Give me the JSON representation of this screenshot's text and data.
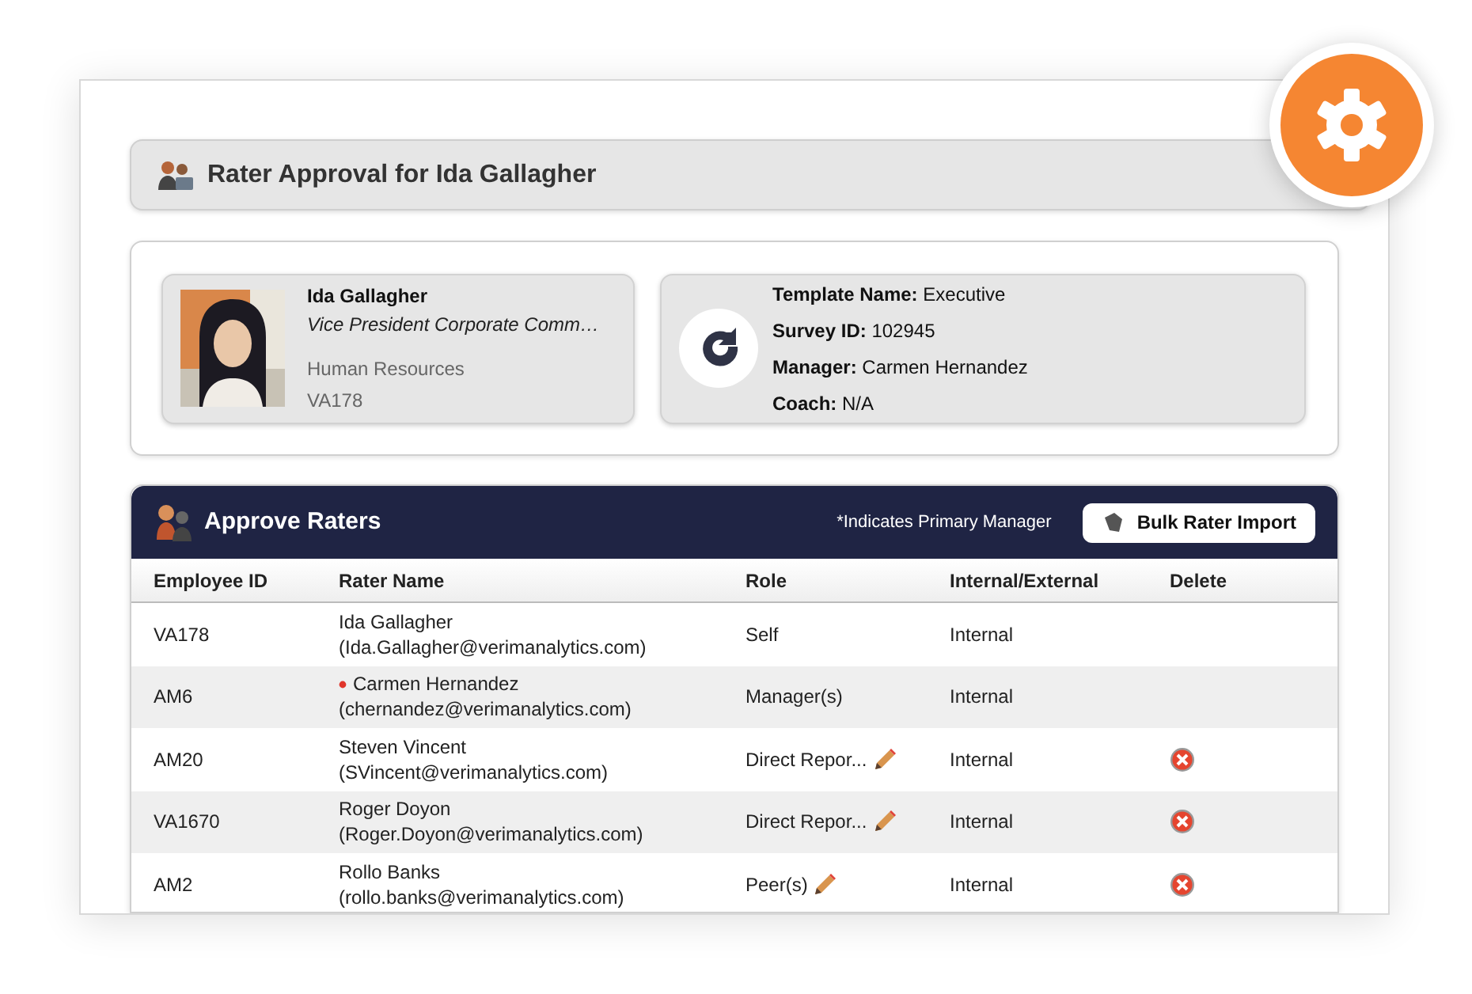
{
  "header": {
    "title": "Rater Approval for Ida Gallagher"
  },
  "participant": {
    "name": "Ida Gallagher",
    "job_title": "Vice President Corporate Comm…",
    "department": "Human Resources",
    "employee_id": "VA178"
  },
  "survey": {
    "fields": [
      {
        "label": "Template Name:",
        "value": "Executive"
      },
      {
        "label": "Survey ID:",
        "value": "102945"
      },
      {
        "label": "Manager:",
        "value": "Carmen Hernandez"
      },
      {
        "label": "Coach:",
        "value": "N/A"
      }
    ]
  },
  "raters_panel": {
    "title": "Approve Raters",
    "legend": "*Indicates Primary Manager",
    "import_button": "Bulk Rater Import"
  },
  "table": {
    "columns": [
      "Employee ID",
      "Rater Name",
      "Role",
      "Internal/External",
      "Delete"
    ],
    "rows": [
      {
        "employee_id": "VA178",
        "rater_name": "Ida Gallagher",
        "email": "(Ida.Gallagher@verimanalytics.com)",
        "primary": false,
        "role": "Self",
        "editable": false,
        "type": "Internal",
        "deletable": false
      },
      {
        "employee_id": "AM6",
        "rater_name": "Carmen Hernandez",
        "email": "(chernandez@verimanalytics.com)",
        "primary": true,
        "role": "Manager(s)",
        "editable": false,
        "type": "Internal",
        "deletable": false
      },
      {
        "employee_id": "AM20",
        "rater_name": "Steven Vincent",
        "email": "(SVincent@verimanalytics.com)",
        "primary": false,
        "role": "Direct Repor...",
        "editable": true,
        "type": "Internal",
        "deletable": true
      },
      {
        "employee_id": "VA1670",
        "rater_name": "Roger Doyon",
        "email": "(Roger.Doyon@verimanalytics.com)",
        "primary": false,
        "role": "Direct Repor...",
        "editable": true,
        "type": "Internal",
        "deletable": true
      },
      {
        "employee_id": "AM2",
        "rater_name": "Rollo Banks",
        "email": "(rollo.banks@verimanalytics.com)",
        "primary": false,
        "role": "Peer(s)",
        "editable": true,
        "type": "Internal",
        "deletable": true
      }
    ]
  }
}
